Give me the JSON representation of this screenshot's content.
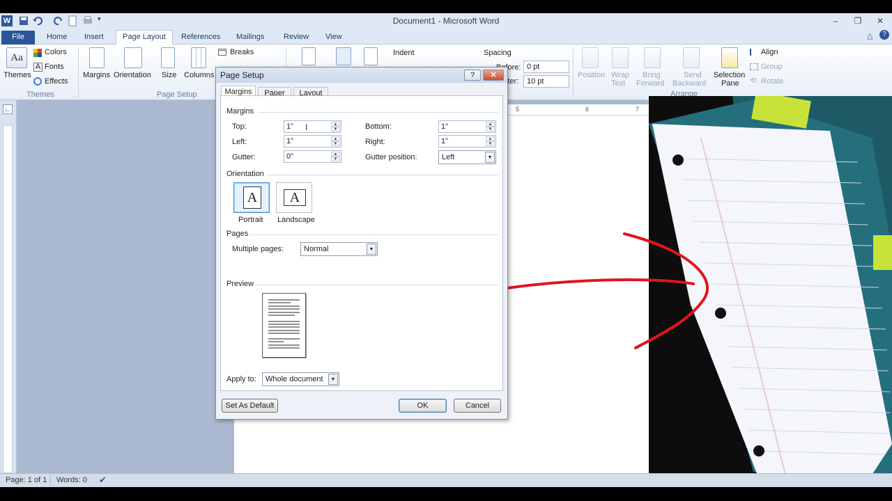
{
  "window": {
    "title": "Document1 - Microsoft Word",
    "minimize": "–",
    "restore": "❐",
    "close": "✕"
  },
  "tabs": {
    "file": "File",
    "home": "Home",
    "insert": "Insert",
    "page_layout": "Page Layout",
    "references": "References",
    "mailings": "Mailings",
    "review": "Review",
    "view": "View"
  },
  "ribbon": {
    "themes": {
      "button": "Themes",
      "colors": "Colors",
      "fonts": "Fonts",
      "effects": "Effects",
      "group": "Themes"
    },
    "page_setup": {
      "margins": "Margins",
      "orientation": "Orientation",
      "size": "Size",
      "columns": "Columns",
      "breaks": "Breaks",
      "group": "Page Setup"
    },
    "paragraph": {
      "indent": "Indent",
      "spacing": "Spacing",
      "before_label": "Before:",
      "before_value": "0 pt",
      "after_label": "After:",
      "after_value": "10 pt"
    },
    "arrange": {
      "position": "Position",
      "wrap_text_1": "Wrap",
      "wrap_text_2": "Text",
      "bring_forward_1": "Bring",
      "bring_forward_2": "Forward",
      "send_backward_1": "Send",
      "send_backward_2": "Backward",
      "selection_pane_1": "Selection",
      "selection_pane_2": "Pane",
      "align": "Align",
      "group": "Group",
      "rotate": "Rotate",
      "group_label": "Arrange"
    }
  },
  "dialog": {
    "title": "Page Setup",
    "help": "?",
    "close": "✕",
    "tabs": [
      "Margins",
      "Paper",
      "Layout"
    ],
    "margins_section": "Margins",
    "top_label": "Top:",
    "top_value": "1\"",
    "bottom_label": "Bottom:",
    "bottom_value": "1\"",
    "left_label": "Left:",
    "left_value": "1\"",
    "right_label": "Right:",
    "right_value": "1\"",
    "gutter_label": "Gutter:",
    "gutter_value": "0\"",
    "gutter_position_label": "Gutter position:",
    "gutter_position_value": "Left",
    "orientation_section": "Orientation",
    "portrait": "Portrait",
    "landscape": "Landscape",
    "orientation_glyph": "A",
    "pages_section": "Pages",
    "multiple_pages_label": "Multiple pages:",
    "multiple_pages_value": "Normal",
    "preview_section": "Preview",
    "apply_to_label": "Apply to:",
    "apply_to_value": "Whole document",
    "set_default": "Set As Default",
    "ok": "OK",
    "cancel": "Cancel"
  },
  "statusbar": {
    "page": "Page: 1 of 1",
    "words": "Words: 0"
  },
  "colors": {
    "accent": "#2a5699",
    "annotation_red": "#e0141e"
  }
}
